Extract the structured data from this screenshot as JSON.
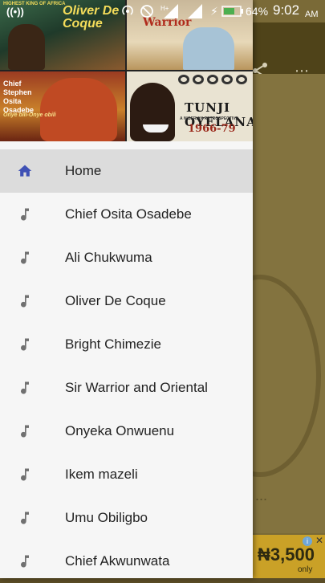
{
  "status_bar": {
    "radio_icon": "((•))",
    "battery_percent": "64%",
    "time": "9:02",
    "ampm": "AM",
    "signal_label": "H+"
  },
  "drawer": {
    "covers": {
      "cover1": {
        "title": "Oliver De Coque",
        "subtitle": "HIGHEST KING OF AFRICA"
      },
      "cover2": {
        "title": "Warrior"
      },
      "cover3": {
        "title": "Chief Stephen Osita Osadebe",
        "script": "Onye bili-Onye obili"
      },
      "cover4": {
        "title": "TUNJI OYELANA",
        "subtitle": "A NIGERIAN RETROSPECTIVE",
        "years": "1966-79"
      }
    },
    "items": [
      {
        "label": "Home",
        "icon": "home-icon",
        "active": true
      },
      {
        "label": "Chief Osita Osadebe",
        "icon": "music-note-icon"
      },
      {
        "label": "Ali Chukwuma",
        "icon": "music-note-icon"
      },
      {
        "label": "Oliver De Coque",
        "icon": "music-note-icon"
      },
      {
        "label": "Bright Chimezie",
        "icon": "music-note-icon"
      },
      {
        "label": "Sir Warrior and Oriental",
        "icon": "music-note-icon"
      },
      {
        "label": "Onyeka Onwuenu",
        "icon": "music-note-icon"
      },
      {
        "label": "Ikem mazeli",
        "icon": "music-note-icon"
      },
      {
        "label": "Umu Obiligbo",
        "icon": "music-note-icon"
      },
      {
        "label": "Chief Akwunwata",
        "icon": "music-note-icon"
      }
    ]
  },
  "ad": {
    "text": "₦3,500",
    "sub": "only"
  },
  "colors": {
    "accent": "#3f51b5",
    "icon_grey": "#707070",
    "active_bg": "#dcdcdc"
  }
}
